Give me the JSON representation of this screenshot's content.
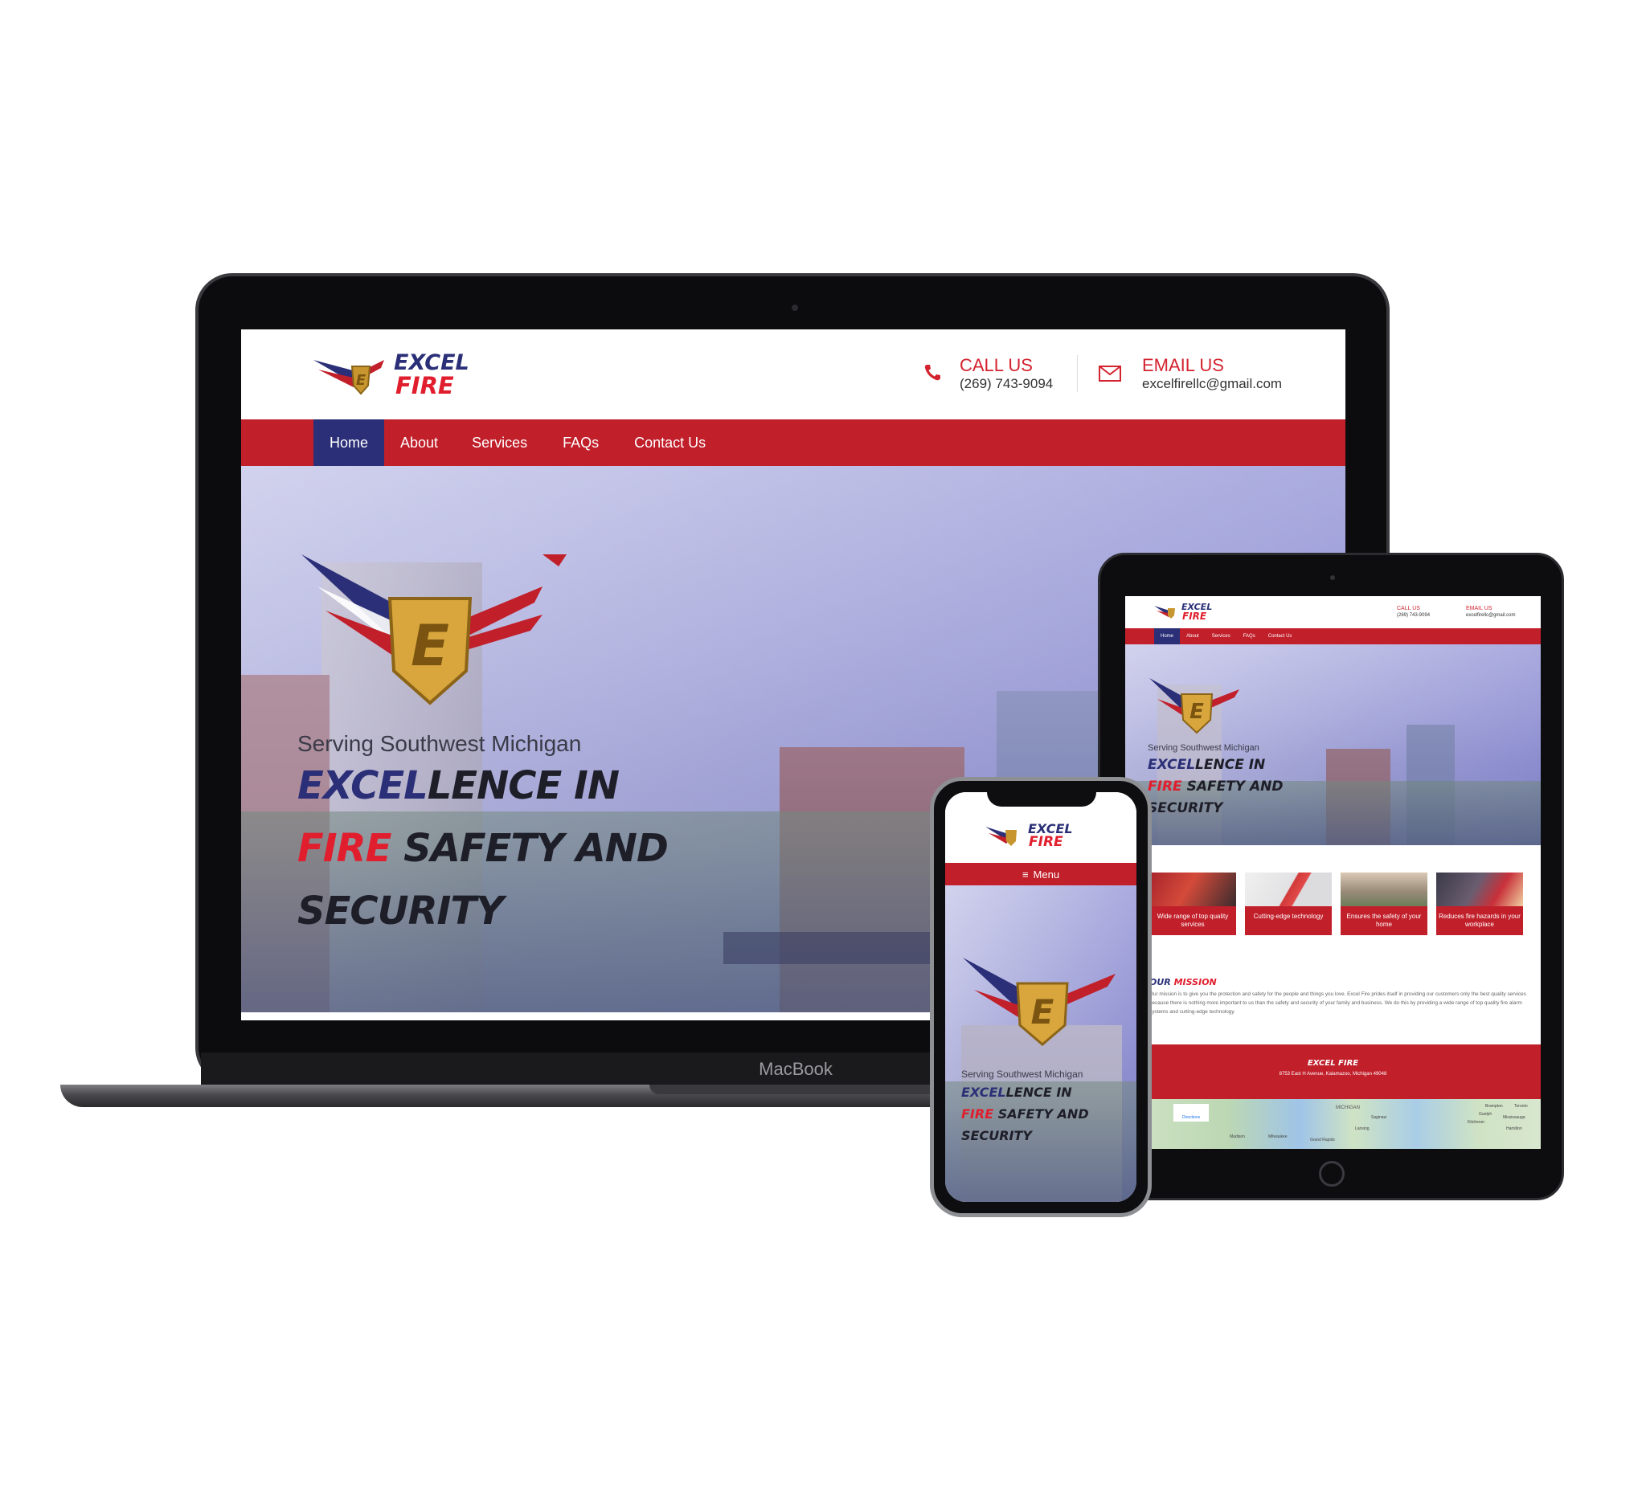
{
  "brand": {
    "line1": "EXCEL",
    "line2": "FIRE",
    "emblem_letter": "E"
  },
  "header": {
    "call_title": "CALL US",
    "call_phone": "(269) 743-9094",
    "email_title": "EMAIL US",
    "email_address": "excelfirellc@gmail.com"
  },
  "nav": {
    "items": [
      {
        "label": "Home",
        "active": true
      },
      {
        "label": "About"
      },
      {
        "label": "Services"
      },
      {
        "label": "FAQs"
      },
      {
        "label": "Contact Us"
      }
    ],
    "mobile_menu_label": "Menu"
  },
  "hero": {
    "tagline": "Serving Southwest Michigan",
    "h_excel": "EXCEL",
    "h_lence_in": "LENCE IN",
    "h_fire": "FIRE",
    "h_safety_and": " SAFETY AND",
    "h_security": "SECURITY"
  },
  "services": [
    {
      "label": "Wide range of top quality services",
      "icon": "technician-photo"
    },
    {
      "label": "Cutting-edge technology",
      "icon": "alarm-panel-photo"
    },
    {
      "label": "Ensures the safety of your home",
      "icon": "family-home-photo"
    },
    {
      "label": "Reduces fire hazards in your workplace",
      "icon": "extinguisher-photo"
    }
  ],
  "mission": {
    "title_our": "OUR",
    "title_mission": "MISSION",
    "text": "Our mission is to give you the protection and safety for the people and things you love. Excel Fire prides itself in providing our customers only the best quality services because there is nothing more important to us than the safety and security of your family and business. We do this by providing a wide range of top quality fire alarm systems and cutting-edge technology."
  },
  "footer": {
    "name": "EXCEL FIRE",
    "address": "8753 East H Avenue, Kalamazoo, Michigan 49048"
  },
  "map": {
    "directions": "Directions",
    "labels": [
      "MICHIGAN",
      "Madison",
      "Milwaukee",
      "Grand Rapids",
      "Lansing",
      "Saginaw",
      "Brampton",
      "Toronto",
      "Guelph",
      "Mississauga",
      "Kitchener",
      "Hamilton"
    ]
  },
  "device_labels": {
    "laptop_brand": "MacBook"
  },
  "colors": {
    "brand_red": "#c11f2a",
    "brand_navy": "#2a2f78",
    "accent_red": "#e01e2d"
  }
}
